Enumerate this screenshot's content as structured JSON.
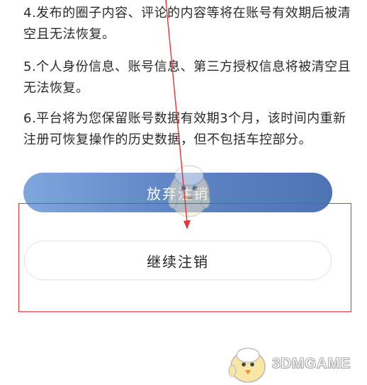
{
  "terms": [
    {
      "line1": "4.发布的圈子内容、评论的内容等将在账号有效期后被清",
      "line2": "空且无法恢复。"
    },
    {
      "line1": "5.个人身份信息、账号信息、第三方授权信息将被清空且",
      "line2": "无法恢复。"
    },
    {
      "line1": "6.平台将为您保留账号数据有效期3个月，该时间内重新",
      "line2": "注册可恢复操作的历史数据，但不包括车控部分。"
    }
  ],
  "buttons": {
    "abandon_label": "放弃注销",
    "continue_label": "继续注销"
  },
  "watermark": {
    "text": "3DMGAME",
    "icon": "bird-mascot-logo"
  },
  "annotations": {
    "arrow_icon": "red-arrow-icon",
    "highlight": "red-highlight-box"
  },
  "colors": {
    "abandon_gradient_start": "#7fa6dd",
    "abandon_gradient_end": "#4e74b6",
    "annotation_red": "#e0353a",
    "text": "#2a2a2a"
  }
}
